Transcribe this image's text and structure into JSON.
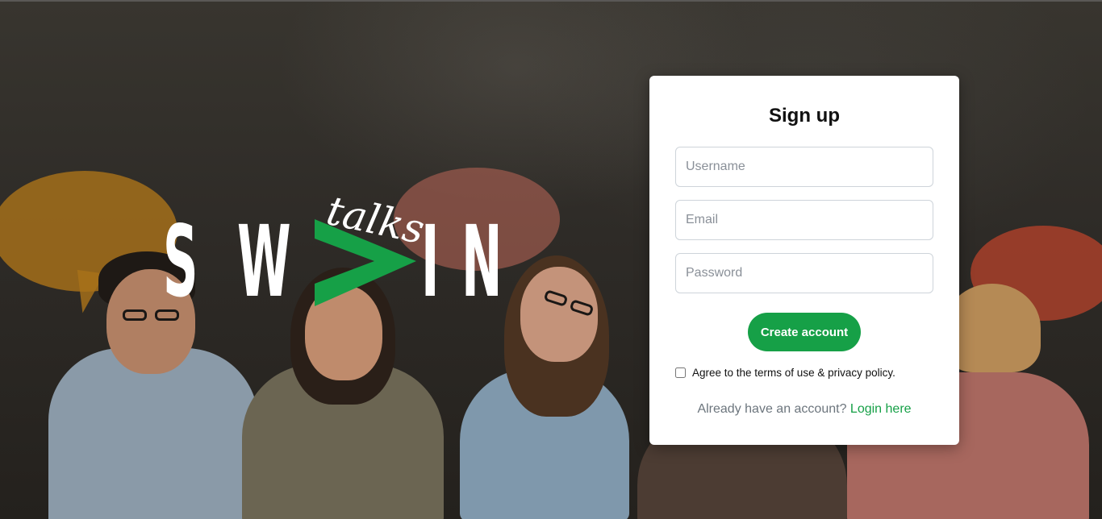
{
  "logo": {
    "letters": [
      "S",
      "W",
      "I",
      "N"
    ],
    "tagline": "talks",
    "accent_color": "#16a047"
  },
  "signup": {
    "title": "Sign up",
    "username_placeholder": "Username",
    "email_placeholder": "Email",
    "password_placeholder": "Password",
    "create_button": "Create account",
    "terms_label": "Agree to the terms of use & privacy policy.",
    "login_prompt": "Already have an account?",
    "login_link": "Login here"
  },
  "colors": {
    "primary": "#16a047",
    "card_bg": "#ffffff",
    "muted_text": "#6c757d"
  }
}
